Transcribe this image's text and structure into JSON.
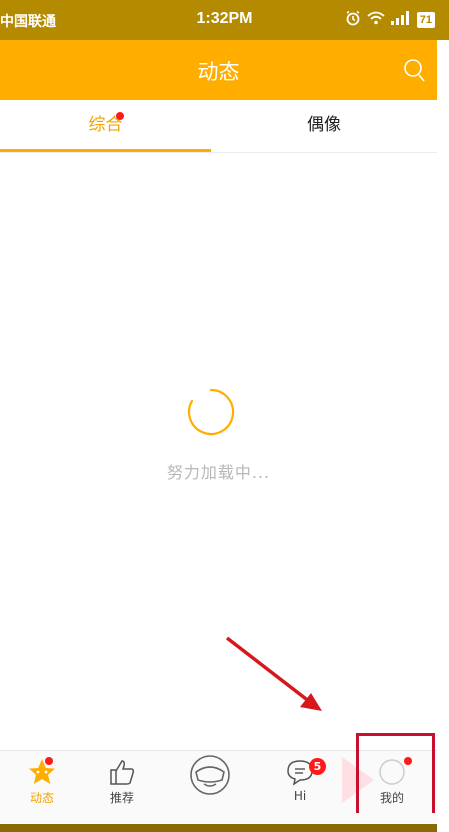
{
  "status_bar": {
    "carrier": "中国联通",
    "time": "1:32PM",
    "battery": "71"
  },
  "header": {
    "title": "动态"
  },
  "tabs": [
    {
      "label": "综合",
      "active": true,
      "badge": true
    },
    {
      "label": "偶像",
      "active": false,
      "badge": false
    }
  ],
  "loading": {
    "text": "努力加载中..."
  },
  "bottom_nav": [
    {
      "label": "动态",
      "icon": "star-icon",
      "active": true
    },
    {
      "label": "推荐",
      "icon": "thumbs-up-icon",
      "active": false
    },
    {
      "label": "",
      "icon": "face-mask-icon",
      "active": false
    },
    {
      "label": "Hi",
      "icon": "chat-bubble-icon",
      "badge": "5"
    },
    {
      "label": "我的",
      "icon": "profile-icon",
      "badge_dot": true
    }
  ],
  "colors": {
    "accent": "#ffae00",
    "status_bar": "#b48a00",
    "badge": "#ff1a1a",
    "annotation": "#c8102e"
  }
}
